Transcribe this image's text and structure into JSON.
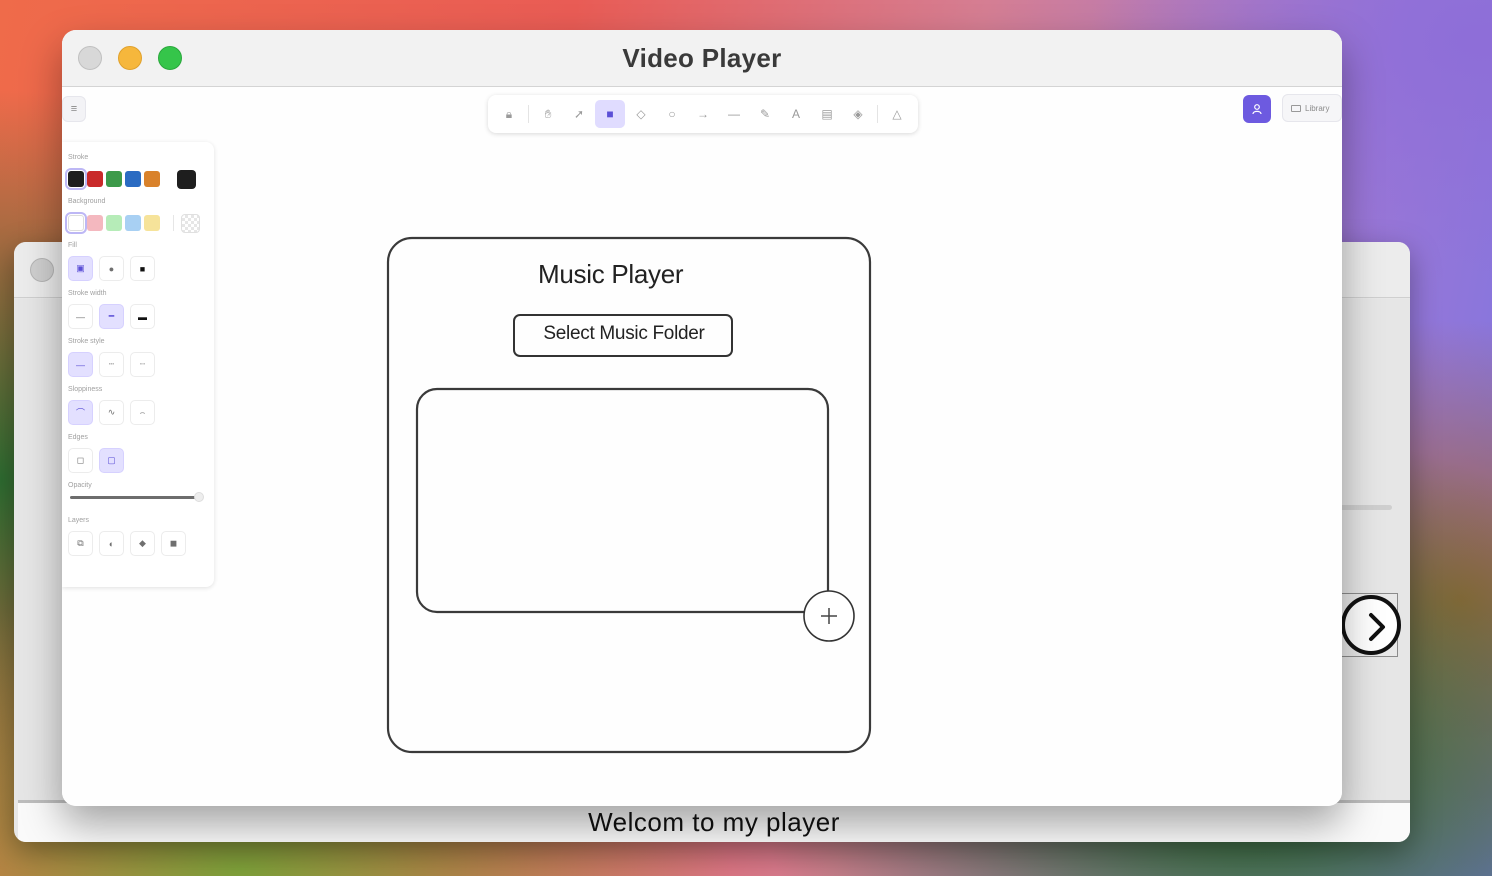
{
  "back_window": {
    "status_text": "Welcom to my player"
  },
  "front_window": {
    "title": "Video Player"
  },
  "toolbar": {
    "tools": [
      {
        "name": "lock-tool",
        "glyph": "🔒︎",
        "active": false
      },
      {
        "sep": true
      },
      {
        "name": "hand-tool",
        "glyph": "✋︎",
        "active": false
      },
      {
        "name": "selection-tool",
        "glyph": "➚",
        "active": false
      },
      {
        "name": "rectangle-tool",
        "glyph": "■",
        "active": true
      },
      {
        "name": "diamond-tool",
        "glyph": "◇",
        "active": false
      },
      {
        "name": "ellipse-tool",
        "glyph": "○",
        "active": false
      },
      {
        "name": "arrow-tool",
        "glyph": "→",
        "active": false
      },
      {
        "name": "line-tool",
        "glyph": "—",
        "active": false
      },
      {
        "name": "draw-tool",
        "glyph": "✎",
        "active": false
      },
      {
        "name": "text-tool",
        "glyph": "A",
        "active": false
      },
      {
        "name": "image-tool",
        "glyph": "▤",
        "active": false
      },
      {
        "name": "eraser-tool",
        "glyph": "◈",
        "active": false
      },
      {
        "sep": true
      },
      {
        "name": "extra-tools",
        "glyph": "△",
        "active": false
      }
    ],
    "library_label": "Library"
  },
  "properties": {
    "stroke_label": "Stroke",
    "stroke_colors": [
      "#1e1e1e",
      "#c92a2a",
      "#3d9a4a",
      "#2a6bc2",
      "#d9822b"
    ],
    "stroke_current": "#1e1e1e",
    "background_label": "Background",
    "background_colors": [
      "#ffffff",
      "#f4b8bf",
      "#b6ecb8",
      "#a8d0f3",
      "#f6e39a"
    ],
    "fill_label": "Fill",
    "stroke_width_label": "Stroke width",
    "stroke_style_label": "Stroke style",
    "sloppiness_label": "Sloppiness",
    "edges_label": "Edges",
    "opacity_label": "Opacity",
    "opacity_value": 1.0,
    "layers_label": "Layers"
  },
  "drawing": {
    "title": "Music Player",
    "button_label": "Select Music Folder"
  }
}
